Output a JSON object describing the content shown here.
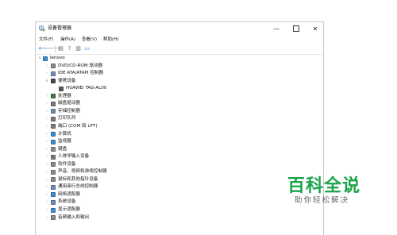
{
  "window": {
    "title": "设备管理器",
    "minimize_glyph": "—",
    "close_glyph": "✕"
  },
  "menu": {
    "items": [
      "文件(F)",
      "操作(A)",
      "查看(V)",
      "帮助(H)"
    ]
  },
  "toolbar": {
    "buttons": [
      {
        "icon": "back-arrow-icon",
        "glyph": "🡐",
        "color": "#2d7fd3"
      },
      {
        "icon": "forward-arrow-icon",
        "glyph": "🡒",
        "color": "#9aa7b4"
      },
      {
        "icon": "properties-icon",
        "glyph": "▤",
        "color": "#666666"
      },
      {
        "icon": "help-icon",
        "glyph": "?",
        "color": "#2d7fd3"
      },
      {
        "icon": "details-icon",
        "glyph": "▥",
        "color": "#666666"
      },
      {
        "icon": "monitor-icon",
        "glyph": "▭",
        "color": "#2d7fd3"
      }
    ]
  },
  "tree": {
    "root": {
      "label": "lenovo",
      "expanded": true,
      "icon": "computer-icon"
    },
    "nodes": [
      {
        "label": "DVD/CD-ROM 驱动器",
        "expanded": false,
        "icon": "dvd-drive-icon",
        "color": "#8a8a8a"
      },
      {
        "label": "IDE ATA/ATAPI 控制器",
        "expanded": false,
        "icon": "ide-controller-icon",
        "color": "#6e8fb3"
      },
      {
        "label": "便携设备",
        "expanded": true,
        "icon": "portable-device-icon",
        "color": "#4a4a4a",
        "children": [
          {
            "label": "HUAWEI TAG-AL00",
            "icon": "phone-icon",
            "color": "#5a5a5a"
          }
        ]
      },
      {
        "label": "处理器",
        "expanded": false,
        "icon": "processor-icon",
        "color": "#3f7d3f"
      },
      {
        "label": "磁盘驱动器",
        "expanded": false,
        "icon": "disk-drive-icon",
        "color": "#7a7a7a"
      },
      {
        "label": "存储控制器",
        "expanded": false,
        "icon": "storage-controller-icon",
        "color": "#6e8fb3"
      },
      {
        "label": "打印队列",
        "expanded": false,
        "icon": "printer-icon",
        "color": "#7a7a7a"
      },
      {
        "label": "端口 (COM 和 LPT)",
        "expanded": false,
        "icon": "port-icon",
        "color": "#7a7a7a"
      },
      {
        "label": "计算机",
        "expanded": false,
        "icon": "computer-icon",
        "color": "#3a8fd6"
      },
      {
        "label": "监视器",
        "expanded": false,
        "icon": "monitor-icon",
        "color": "#3a8fd6"
      },
      {
        "label": "键盘",
        "expanded": false,
        "icon": "keyboard-icon",
        "color": "#8a8a8a"
      },
      {
        "label": "人体学输入设备",
        "expanded": false,
        "icon": "hid-icon",
        "color": "#7a7a7a"
      },
      {
        "label": "软件设备",
        "expanded": false,
        "icon": "software-device-icon",
        "color": "#8a8a8a"
      },
      {
        "label": "声音、视频和游戏控制器",
        "expanded": false,
        "icon": "sound-icon",
        "color": "#8a8a8a"
      },
      {
        "label": "鼠标和其他指针设备",
        "expanded": false,
        "icon": "mouse-icon",
        "color": "#8a8a8a"
      },
      {
        "label": "通用串行总线控制器",
        "expanded": false,
        "icon": "usb-icon",
        "color": "#6e8fb3"
      },
      {
        "label": "网络适配器",
        "expanded": false,
        "icon": "network-adapter-icon",
        "color": "#3a8fd6"
      },
      {
        "label": "系统设备",
        "expanded": false,
        "icon": "system-device-icon",
        "color": "#6e8fb3"
      },
      {
        "label": "显示适配器",
        "expanded": false,
        "icon": "display-adapter-icon",
        "color": "#3a8fd6"
      },
      {
        "label": "音频输入和输出",
        "expanded": false,
        "icon": "audio-io-icon",
        "color": "#8a8a8a"
      }
    ]
  },
  "watermark": {
    "title": "百科全说",
    "subtitle": "助你轻松解决",
    "color": "#1aa34a"
  }
}
